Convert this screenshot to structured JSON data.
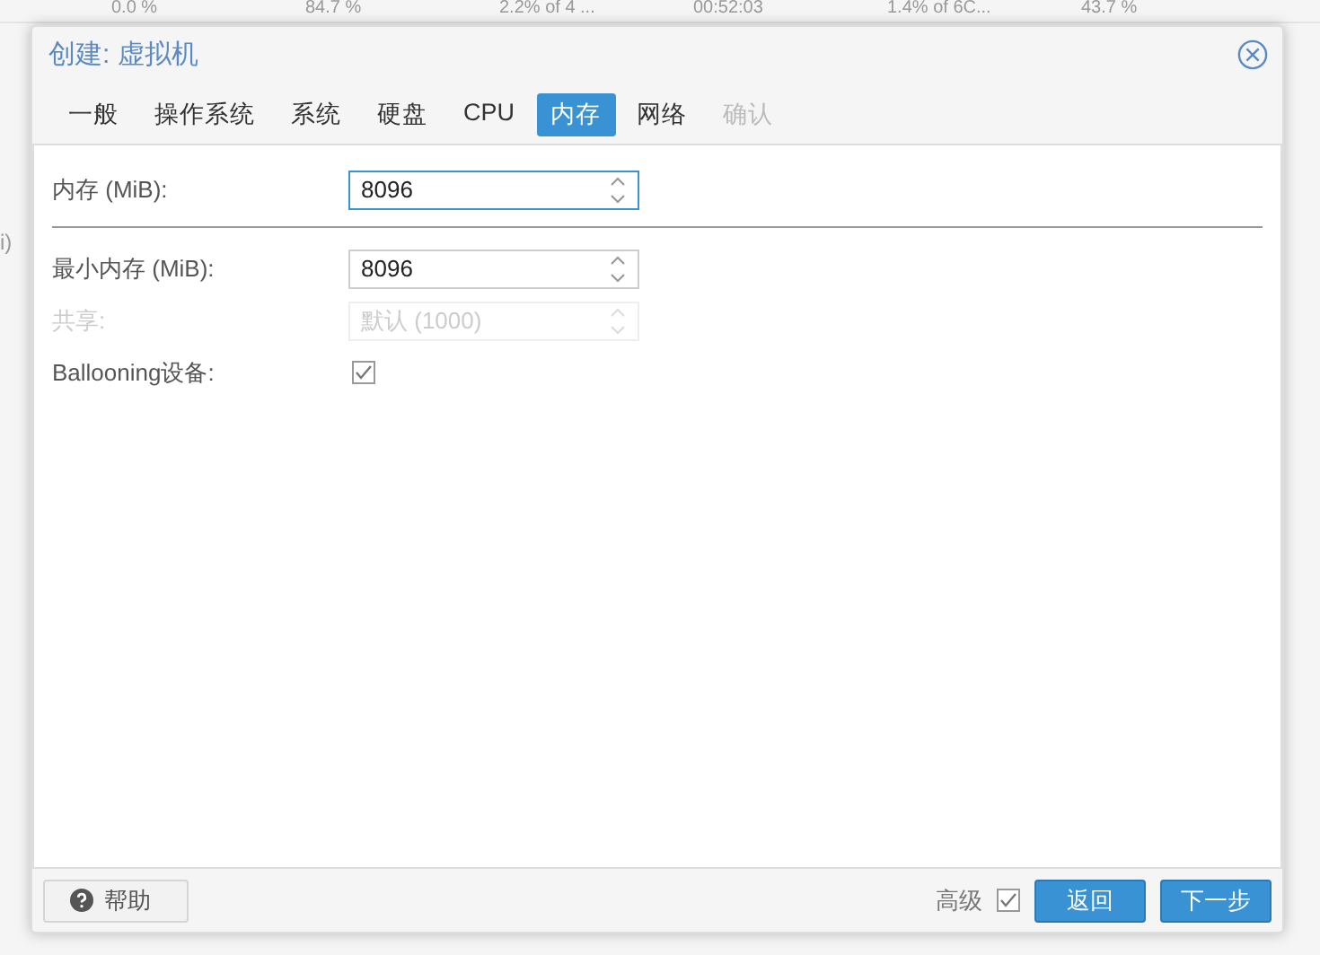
{
  "background_row": [
    "0.0 %",
    "84.7 %",
    "2.2% of 4 ...",
    "00:52:03",
    "1.4% of 6C...",
    "43.7 %"
  ],
  "background_side_text": "i)",
  "window": {
    "title": "创建: 虚拟机"
  },
  "tabs": [
    {
      "label": "一般",
      "selected": false,
      "disabled": false
    },
    {
      "label": "操作系统",
      "selected": false,
      "disabled": false
    },
    {
      "label": "系统",
      "selected": false,
      "disabled": false
    },
    {
      "label": "硬盘",
      "selected": false,
      "disabled": false
    },
    {
      "label": "CPU",
      "selected": false,
      "disabled": false
    },
    {
      "label": "内存",
      "selected": true,
      "disabled": false
    },
    {
      "label": "网络",
      "selected": false,
      "disabled": false
    },
    {
      "label": "确认",
      "selected": false,
      "disabled": true
    }
  ],
  "fields": [
    {
      "kind": "spinner",
      "label": "内存 (MiB):",
      "value": "8096",
      "focused": true,
      "disabled": false
    },
    {
      "kind": "separator"
    },
    {
      "kind": "spinner",
      "label": "最小内存 (MiB):",
      "value": "8096",
      "focused": false,
      "disabled": false
    },
    {
      "kind": "spinner",
      "label": "共享:",
      "placeholder": "默认 (1000)",
      "focused": false,
      "disabled": true
    },
    {
      "kind": "checkbox",
      "label": "Ballooning设备:",
      "checked": true,
      "disabled": false
    }
  ],
  "footer": {
    "help_button": "帮助",
    "advanced": {
      "label": "高级",
      "checked": true
    },
    "back_button": "返回",
    "next_button": "下一步"
  }
}
